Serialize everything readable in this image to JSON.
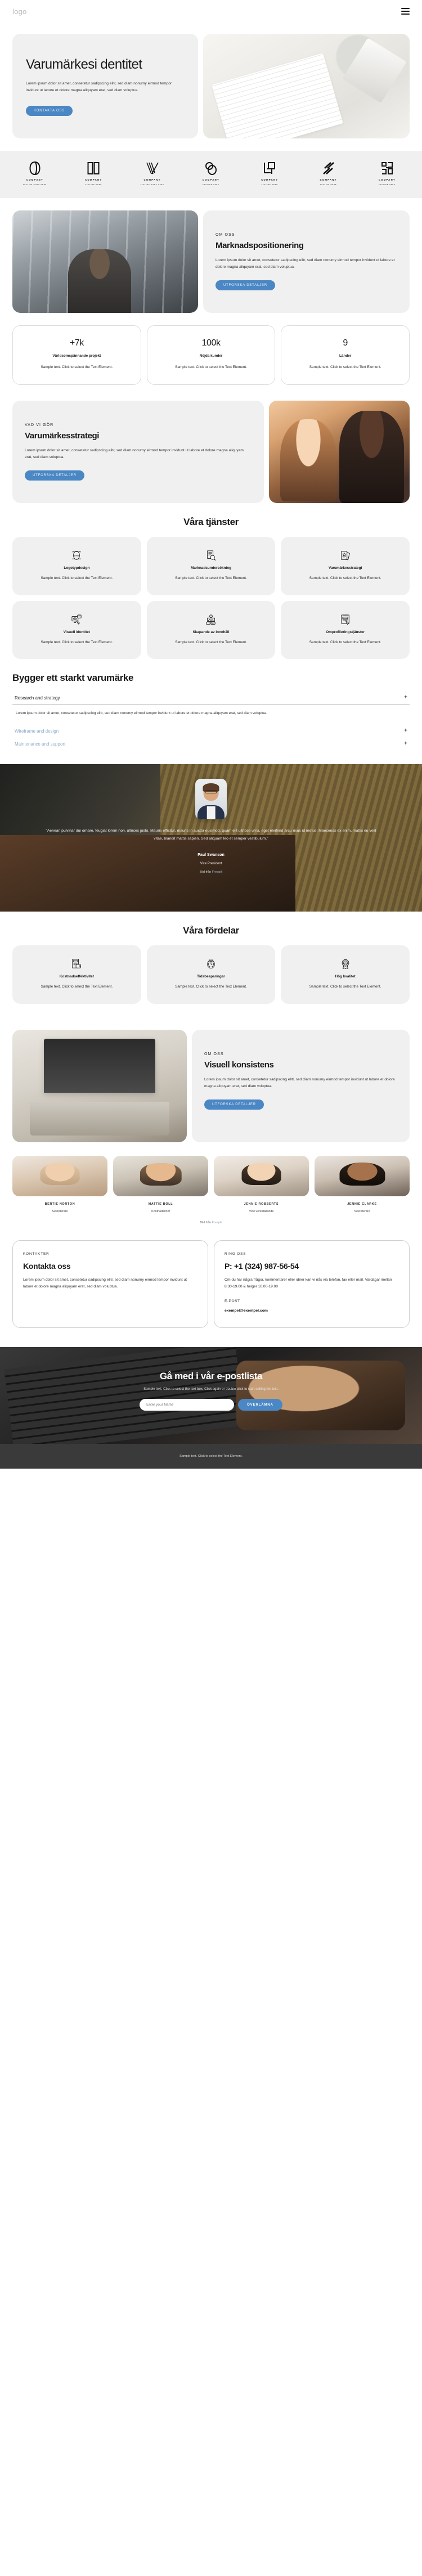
{
  "header": {
    "logo": "logo",
    "menu_icon": "hamburger-menu"
  },
  "hero": {
    "title": "Varumärkesi dentitet",
    "paragraph": "Lorem ipsum dolor sit amet, consetetur sadipscing elitr, sed diam nonumy eirmod tempor invidunt ut labore et dolore magna aliquyam erat, sed diam voluptua.",
    "cta": "KONTAKTA OSS"
  },
  "logos": [
    {
      "name": "COMPANY",
      "tagline": "TAGLINE GOES HERE"
    },
    {
      "name": "COMPANY",
      "tagline": "TAGLINE HERE"
    },
    {
      "name": "COMPANY",
      "tagline": "TAGLINE GOES HERE"
    },
    {
      "name": "COMPANY",
      "tagline": "TAGLINE HERE"
    },
    {
      "name": "COMPANY",
      "tagline": "TAGLINE HERE"
    },
    {
      "name": "COMPANY",
      "tagline": "TAGLINE HERE"
    },
    {
      "name": "COMPANY",
      "tagline": "TAGLINE HERE"
    }
  ],
  "about": {
    "eyebrow": "OM OSS",
    "title": "Marknadspositionering",
    "paragraph": "Lorem ipsum dolor sit amet, consetetur sadipscing elitr, sed diam nonumy eirmod tempor invidunt ut labore et dolore magna aliquyam erat, sed diam voluptua.",
    "cta": "UTFORSKA DETALJER"
  },
  "stats": [
    {
      "number": "+7k",
      "label": "Världsomspännande projekt",
      "text": "Sample text. Click to select the Text Element."
    },
    {
      "number": "100k",
      "label": "Nöjda kunder",
      "text": "Sample text. Click to select the Text Element."
    },
    {
      "number": "9",
      "label": "Länder",
      "text": "Sample text. Click to select the Text Element."
    }
  ],
  "strategy": {
    "eyebrow": "VAD VI GÖR",
    "title": "Varumärkesstrategi",
    "paragraph": "Lorem ipsum dolor sit amet, consetetur sadipscing elitr, sed diam nonumy eirmod tempor invidunt ut labore et dolore magna aliquyam erat, sed diam voluptua.",
    "cta": "UTFORSKA DETALJER"
  },
  "services": {
    "title": "Våra tjänster",
    "items": [
      {
        "icon": "logo-design-icon",
        "title": "Logotypdesign",
        "text": "Sample text. Click to select the Text Element."
      },
      {
        "icon": "market-research-icon",
        "title": "Marknadsundersökning",
        "text": "Sample text. Click to select the Text Element."
      },
      {
        "icon": "brand-strategy-icon",
        "title": "Varumärkesstrategi",
        "text": "Sample text. Click to select the Text Element."
      },
      {
        "icon": "visual-identity-icon",
        "title": "Visuell identitet",
        "text": "Sample text. Click to select the Text Element."
      },
      {
        "icon": "content-creation-icon",
        "title": "Skapande av innehåll",
        "text": "Sample text. Click to select the Text Element."
      },
      {
        "icon": "rebranding-icon",
        "title": "Omprofileringstjänster",
        "text": "Sample text. Click to select the Text Element."
      }
    ]
  },
  "accordion": {
    "title": "Bygger ett starkt varumärke",
    "items": [
      {
        "label": "Research and strategy",
        "icon": "plus-icon",
        "open": true,
        "body": "Lorem ipsum dolor sit amet, consetetur sadipscing elitr, sed diam nonumy eirmod tempor invidunt ut labore et dolore magna aliquyam erat, sed diam voluptua."
      },
      {
        "label": "Wireframe and design",
        "icon": "plus-icon",
        "open": false,
        "body": ""
      },
      {
        "label": "Maintenance and support",
        "icon": "plus-icon",
        "open": false,
        "body": ""
      }
    ]
  },
  "testimonial": {
    "quote": "\"Aenean pulvinar dui ornare, feugiat lorem non, ultrices justo. Mauris efficitur, mauris in auctor euismod, quam elit ultrices urna, eget eleifend arcu risus id metus. Maecenas ex enim, mattis eu velit vitae, blandit mattis sapien. Sed aliquam leo et semper vestibulum.\"",
    "name": "Paul Swanson",
    "role": "Vice President",
    "credit_prefix": "Bild från ",
    "credit_link": "Freepik"
  },
  "benefits": {
    "title": "Våra fördelar",
    "items": [
      {
        "icon": "cost-efficiency-icon",
        "title": "Kostnadseffektivitet",
        "text": "Sample text. Click to select the Text Element."
      },
      {
        "icon": "time-saving-icon",
        "title": "Tidsbesparingar",
        "text": "Sample text. Click to select the Text Element."
      },
      {
        "icon": "high-quality-icon",
        "title": "Hög kvalitet",
        "text": "Sample text. Click to select the Text Element."
      }
    ]
  },
  "consistency": {
    "eyebrow": "OM OSS",
    "title": "Visuell konsistens",
    "paragraph": "Lorem ipsum dolor sit amet, consetetur sadipscing elitr, sed diam nonumy eirmod tempor invidunt ut labore et dolore magna aliquyam erat, sed diam voluptua.",
    "cta": "UTFORSKA DETALJER"
  },
  "team": {
    "members": [
      {
        "name": "BERTIE NORTON",
        "role": "Sekreterare"
      },
      {
        "name": "MATTIE BOLL",
        "role": "Kostnadschef"
      },
      {
        "name": "JENNIE ROBBERTS",
        "role": "Vice verkställande"
      },
      {
        "name": "JENNIE CLARKE",
        "role": "Sekreterare"
      }
    ],
    "credit_prefix": "Bild från ",
    "credit_link": "Freepik"
  },
  "contact": {
    "left": {
      "eyebrow": "KONTAKTER",
      "title": "Kontakta oss",
      "paragraph": "Lorem ipsum dolor sit amet, consetetur sadipscing elitr, sed diam nonumy eirmod tempor invidunt ut labore et dolore magna aliquyam erat, sed diam voluptua."
    },
    "right": {
      "eyebrow": "RING OSS",
      "phone": "P: +1 (324) 987-56-54",
      "paragraph": "Om du har några frågor, kommentarer eller idéer kan vi nås via telefon, fax eller mail. Vardagar mellan 8.30-19.00 & helger 10.00-19.00",
      "email_label": "E-POST",
      "email": "exempel@exempel.com"
    }
  },
  "newsletter": {
    "title": "Gå med i vår e-postlista",
    "subtitle": "Sample text. Click to select the text box. Click again or double click to start editing the text.",
    "placeholder": "Enter your Name",
    "button": "ÖVERLÄMNA"
  },
  "footer": {
    "text": "Sample text. Click to select the Text Element."
  },
  "colors": {
    "accent": "#4a87c4",
    "card": "#f0f0f0",
    "footer_bg": "#3a3a3a",
    "link": "#8aacc8"
  }
}
